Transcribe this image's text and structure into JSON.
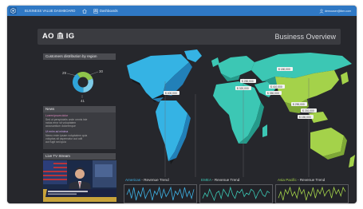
{
  "topbar": {
    "app_title": "BUSINESS VALUE DASHBOARD",
    "crumb": "Dashboards",
    "user": "demouser@ibm.com"
  },
  "header": {
    "org_prefix": "AO",
    "org_suffix": "IG",
    "title": "Business Overview"
  },
  "donut": {
    "title": "Customers distribution by region",
    "segments": [
      {
        "value": 29,
        "color": "#8fc54a"
      },
      {
        "value": 30,
        "color": "#7ecbe8"
      },
      {
        "value": 41,
        "color": "#2fa4d9"
      }
    ],
    "labels": [
      "29",
      "30",
      "41"
    ]
  },
  "news": {
    "title": "News",
    "items": [
      {
        "headline": "Lorem ipsum dolor",
        "lines": [
          "Sed ut perspiciatis unde omnis iste",
          "natus error sit voluptatem",
          "accusantium doloremque"
        ]
      },
      {
        "headline": "Ut enim ad minima",
        "lines": [
          "Nemo enim ipsam voluptatem quia",
          "voluptas sit aspernatur aut odit",
          "aut fugit sed quia"
        ]
      }
    ]
  },
  "live": {
    "title": "Live TV Stream"
  },
  "map": {
    "callouts": [
      "$ 400,000",
      "$ 250,000",
      "$ 320,000",
      "$ 410,000",
      "$ 180,000",
      "$ 350,000",
      "$ 290,000",
      "$ 210,000",
      "$ 150,000"
    ]
  },
  "trends": [
    {
      "region": "Americas",
      "suffix": " - Revenue Trend",
      "color": "#3fb3e6",
      "values": [
        5,
        8,
        3,
        9,
        2,
        7,
        4,
        9,
        3,
        6,
        8,
        2,
        7,
        5,
        9,
        3,
        8,
        4,
        6,
        9,
        2,
        7,
        5,
        8,
        3,
        9,
        4,
        7,
        3,
        8
      ]
    },
    {
      "region": "EMEA",
      "suffix": " - Revenue Trend",
      "color": "#3cc7b4",
      "values": [
        3,
        6,
        4,
        8,
        5,
        2,
        6,
        7,
        3,
        8,
        6,
        4,
        9,
        5,
        3,
        7,
        6,
        8,
        4,
        6,
        5,
        8,
        7,
        3,
        6,
        8,
        5,
        4,
        7,
        6
      ]
    },
    {
      "region": "Asia Pacific",
      "suffix": " - Revenue Trend",
      "color": "#a4d24a",
      "values": [
        4,
        7,
        3,
        8,
        6,
        9,
        5,
        7,
        4,
        9,
        6,
        8,
        3,
        7,
        5,
        9,
        4,
        8,
        6,
        9,
        5,
        7,
        8,
        4,
        9,
        6,
        8,
        5,
        9,
        7
      ]
    }
  ]
}
